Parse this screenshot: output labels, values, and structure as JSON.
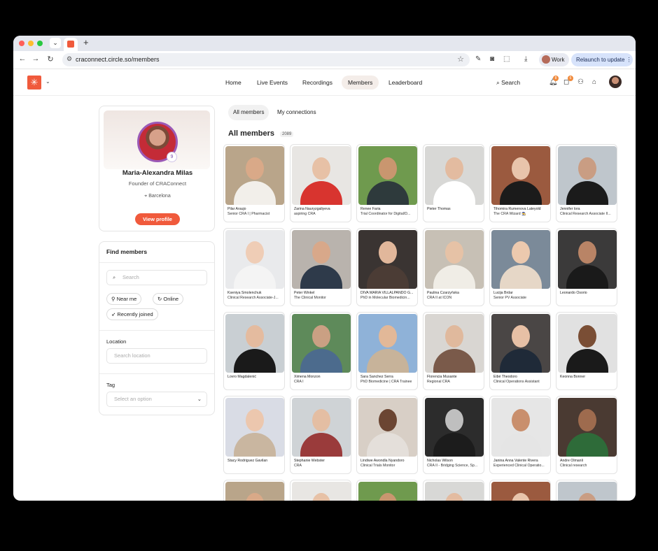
{
  "browser": {
    "tab_dropdown": "⌄",
    "new_tab": "+",
    "url": "craconnect.circle.so/members",
    "profile": "Work",
    "relaunch": "Relaunch to update"
  },
  "header": {
    "nav": [
      "Home",
      "Live Events",
      "Recordings",
      "Members",
      "Leaderboard"
    ],
    "active_nav": "Members",
    "search": "Search",
    "notif_badge": "8",
    "msg_badge": "6"
  },
  "profile_card": {
    "name": "Maria-Alexandra Milas",
    "title": "Founder of CRAConnect",
    "location": "Barcelona",
    "level": "9",
    "button": "View profile"
  },
  "find_members": {
    "title": "Find members",
    "search_placeholder": "Search",
    "chips": [
      "Near me",
      "Online",
      "Recently joined"
    ],
    "location_label": "Location",
    "location_placeholder": "Search location",
    "tag_label": "Tag",
    "tag_placeholder": "Select an option"
  },
  "main": {
    "tabs": [
      "All members",
      "My connections"
    ],
    "heading": "All members",
    "count": "2089"
  },
  "members": [
    {
      "name": "Pilar Araujo",
      "role": "Senior CRA I | Pharmacist"
    },
    {
      "name": "Zarina Nauryzgaliyeva",
      "role": "aspiring CRA"
    },
    {
      "name": "Renee Faria",
      "role": "Trial Coordinator for Digital/D..."
    },
    {
      "name": "Pieter Thomas",
      "role": ""
    },
    {
      "name": "Tihomira Rumenova Lateyold",
      "role": "The CRA Wizard 🧙"
    },
    {
      "name": "Jennifer lora",
      "role": "Clinical Research Associate II..."
    },
    {
      "name": "Kseniya Smolenchuk",
      "role": "Clinical Research Associate-J..."
    },
    {
      "name": "Peter Winkel",
      "role": "The Clinical Monitor"
    },
    {
      "name": "DIVA MARÍA VILLALPANDO G...",
      "role": "PhD in Molecular Biomedicin..."
    },
    {
      "name": "Paulina Czarzyńska",
      "role": "CRA II at ICON"
    },
    {
      "name": "Lucija Brdar",
      "role": "Senior PV Associate"
    },
    {
      "name": "Leonardo Osorio",
      "role": ""
    },
    {
      "name": "Lovro Magdalenić",
      "role": ""
    },
    {
      "name": "Ximena Monzon",
      "role": "CRA I"
    },
    {
      "name": "Sara Sanchez Serra",
      "role": "PhD Biomedicine | CRA Trainee"
    },
    {
      "name": "Florencia Musante",
      "role": "Regional CRA"
    },
    {
      "name": "Eibé Theodoro",
      "role": "Clinical Operations Assistant"
    },
    {
      "name": "Keonna Bonner",
      "role": ""
    },
    {
      "name": "Stacy Rodriguez Gavilan",
      "role": ""
    },
    {
      "name": "Stephanie Webster",
      "role": "CRA"
    },
    {
      "name": "Lindiwe Awondla Nyandoro",
      "role": "Clinical Trials Monitor"
    },
    {
      "name": "Nicholas Wilson",
      "role": "CRA II - Bridging Science, Sp..."
    },
    {
      "name": "Janina Anna Valente Rivera",
      "role": "Experienced Clinical Operatio..."
    },
    {
      "name": "Andre Olmanli",
      "role": "Clinical research"
    }
  ],
  "colors": {
    "accent": "#f05a3c",
    "avatar_ring": "#9b59b6",
    "window_bg": "#ffffff",
    "outer_bg": "#000000"
  }
}
